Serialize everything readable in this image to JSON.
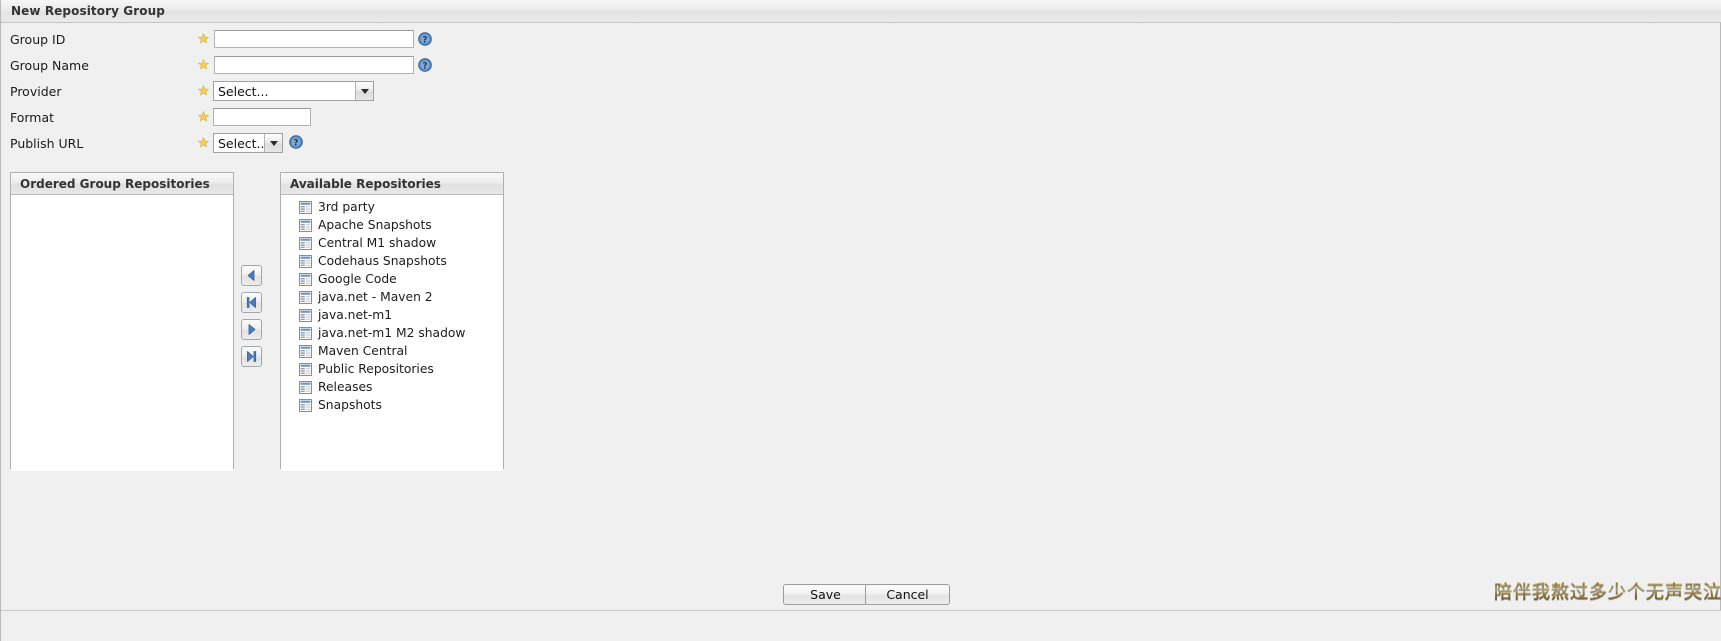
{
  "window": {
    "title": "New Repository Group"
  },
  "form": {
    "fields": [
      {
        "label": "Group ID",
        "control": "text",
        "value": "",
        "placeholder": "",
        "required_icon": "star-icon",
        "help_icon": "help-icon",
        "has_help": true
      },
      {
        "label": "Group Name",
        "control": "text",
        "value": "",
        "placeholder": "",
        "required_icon": "star-icon",
        "help_icon": "help-icon",
        "has_help": true
      },
      {
        "label": "Provider",
        "control": "select",
        "value": "Select...",
        "required_icon": "star-icon",
        "has_help": false
      },
      {
        "label": "Format",
        "control": "text",
        "value": "",
        "placeholder": "",
        "required_icon": "star-icon",
        "has_help": false
      },
      {
        "label": "Publish URL",
        "control": "select",
        "value": "Select...",
        "required_icon": "star-icon",
        "help_icon": "help-icon",
        "has_help": true
      }
    ]
  },
  "ordered_group_repositories": {
    "title": "Ordered Group Repositories",
    "items": []
  },
  "available_repositories": {
    "title": "Available Repositories",
    "item_icon": "repository-icon",
    "items": [
      "3rd party",
      "Apache Snapshots",
      "Central M1 shadow",
      "Codehaus Snapshots",
      "Google Code",
      "java.net - Maven 2",
      "java.net-m1",
      "java.net-m1 M2 shadow",
      "Maven Central",
      "Public Repositories",
      "Releases",
      "Snapshots"
    ]
  },
  "transfer_buttons": [
    {
      "name": "move-left-selected",
      "icon": "arrow-left-icon",
      "glyph": "◀"
    },
    {
      "name": "move-left-all",
      "icon": "arrow-left-all-icon",
      "glyph": "⏮"
    },
    {
      "name": "move-right-selected",
      "icon": "arrow-right-icon",
      "glyph": "▶"
    },
    {
      "name": "move-right-all",
      "icon": "arrow-right-all-icon",
      "glyph": "⏭"
    }
  ],
  "footer": {
    "save_label": "Save",
    "cancel_label": "Cancel"
  },
  "watermark": {
    "text": "陪伴我熬过多少个无声哭泣"
  },
  "colors": {
    "required_star": "#f4c430",
    "help_icon": "#3a6ea5",
    "panel_border": "#b0b0b0",
    "arrow_blue": "#3f6fb5",
    "watermark_gold": "#d4b663"
  }
}
